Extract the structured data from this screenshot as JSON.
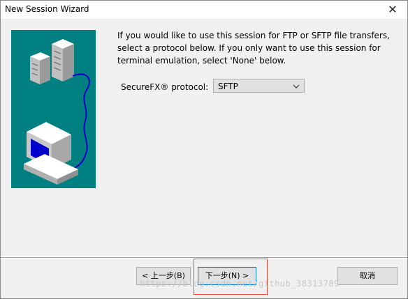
{
  "window": {
    "title": "New Session Wizard"
  },
  "content": {
    "description_lines": [
      "If you would like to use this session for FTP or SFTP file transfers,",
      "select a protocol below.  If you only want to use this session for",
      "terminal emulation, select 'None' below."
    ],
    "protocol": {
      "label": "SecureFX® protocol:",
      "value": "SFTP"
    }
  },
  "buttons": {
    "back": "< 上一步(B)",
    "next": "下一步(N) >",
    "cancel": "取消"
  },
  "watermark": "https://blog.csdn.net/github_38313789",
  "colors": {
    "art_background": "#008080",
    "highlight": "#e74c3c"
  }
}
